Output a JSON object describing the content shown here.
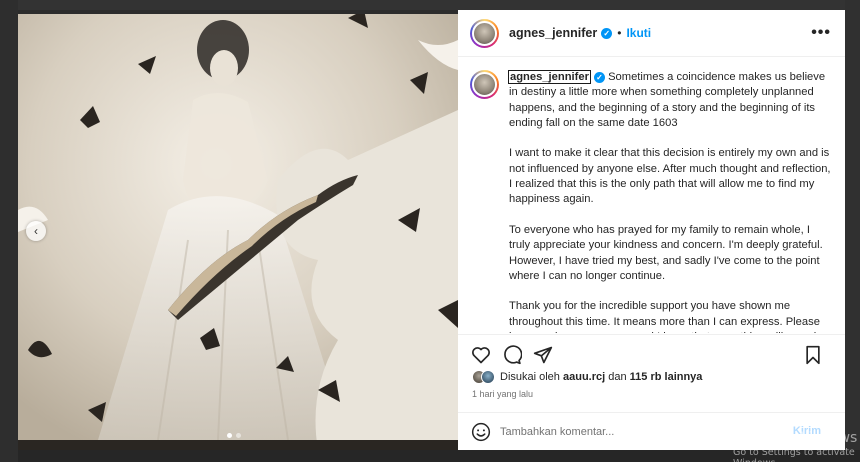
{
  "post": {
    "username": "agnes_jennifer",
    "follow_label": "Ikuti",
    "separator": "•",
    "more_label": "•••",
    "verified_glyph": "✓"
  },
  "caption": {
    "paragraphs": [
      "Sometimes a coincidence makes us believe in destiny a little more when something completely unplanned happens, and the beginning of a story and the beginning of its ending fall on the same date 1603",
      "I want to make it clear that this decision is entirely my own and is not influenced by anyone else. After much thought and reflection, I realized that this is the only path that will allow me to find my happiness again.",
      "To everyone who has prayed for my family to remain whole, I truly appreciate your kindness and concern. I'm deeply grateful. However, I have tried my best, and sadly I've come to the point where I can no longer continue.",
      "Thank you for the incredible support you have shown me throughout this time. It means more than I can express. Please keep me in your prayers, and I hope that everything will soon be resolved so that I can move forward with my life."
    ]
  },
  "likes": {
    "prefix": "Disukai oleh",
    "first_user": "aauu.rcj",
    "connector": "dan",
    "others": "115 rb lainnya"
  },
  "time_ago": "1 hari yang lalu",
  "comment": {
    "placeholder": "Tambahkan komentar...",
    "post_label": "Kirim"
  },
  "carousel": {
    "prev_glyph": "‹",
    "current_index": 1,
    "total": 2
  },
  "icons": {
    "like": "heart-icon",
    "comment": "comment-icon",
    "share": "share-icon",
    "save": "bookmark-icon",
    "emoji": "emoji-icon"
  },
  "colors": {
    "accent": "#0095f6",
    "post_button_disabled": "#b3dbff",
    "muted_text": "#737373"
  },
  "watermark": {
    "title": "Activate Windows",
    "subtitle": "Go to Settings to activate Windows."
  }
}
